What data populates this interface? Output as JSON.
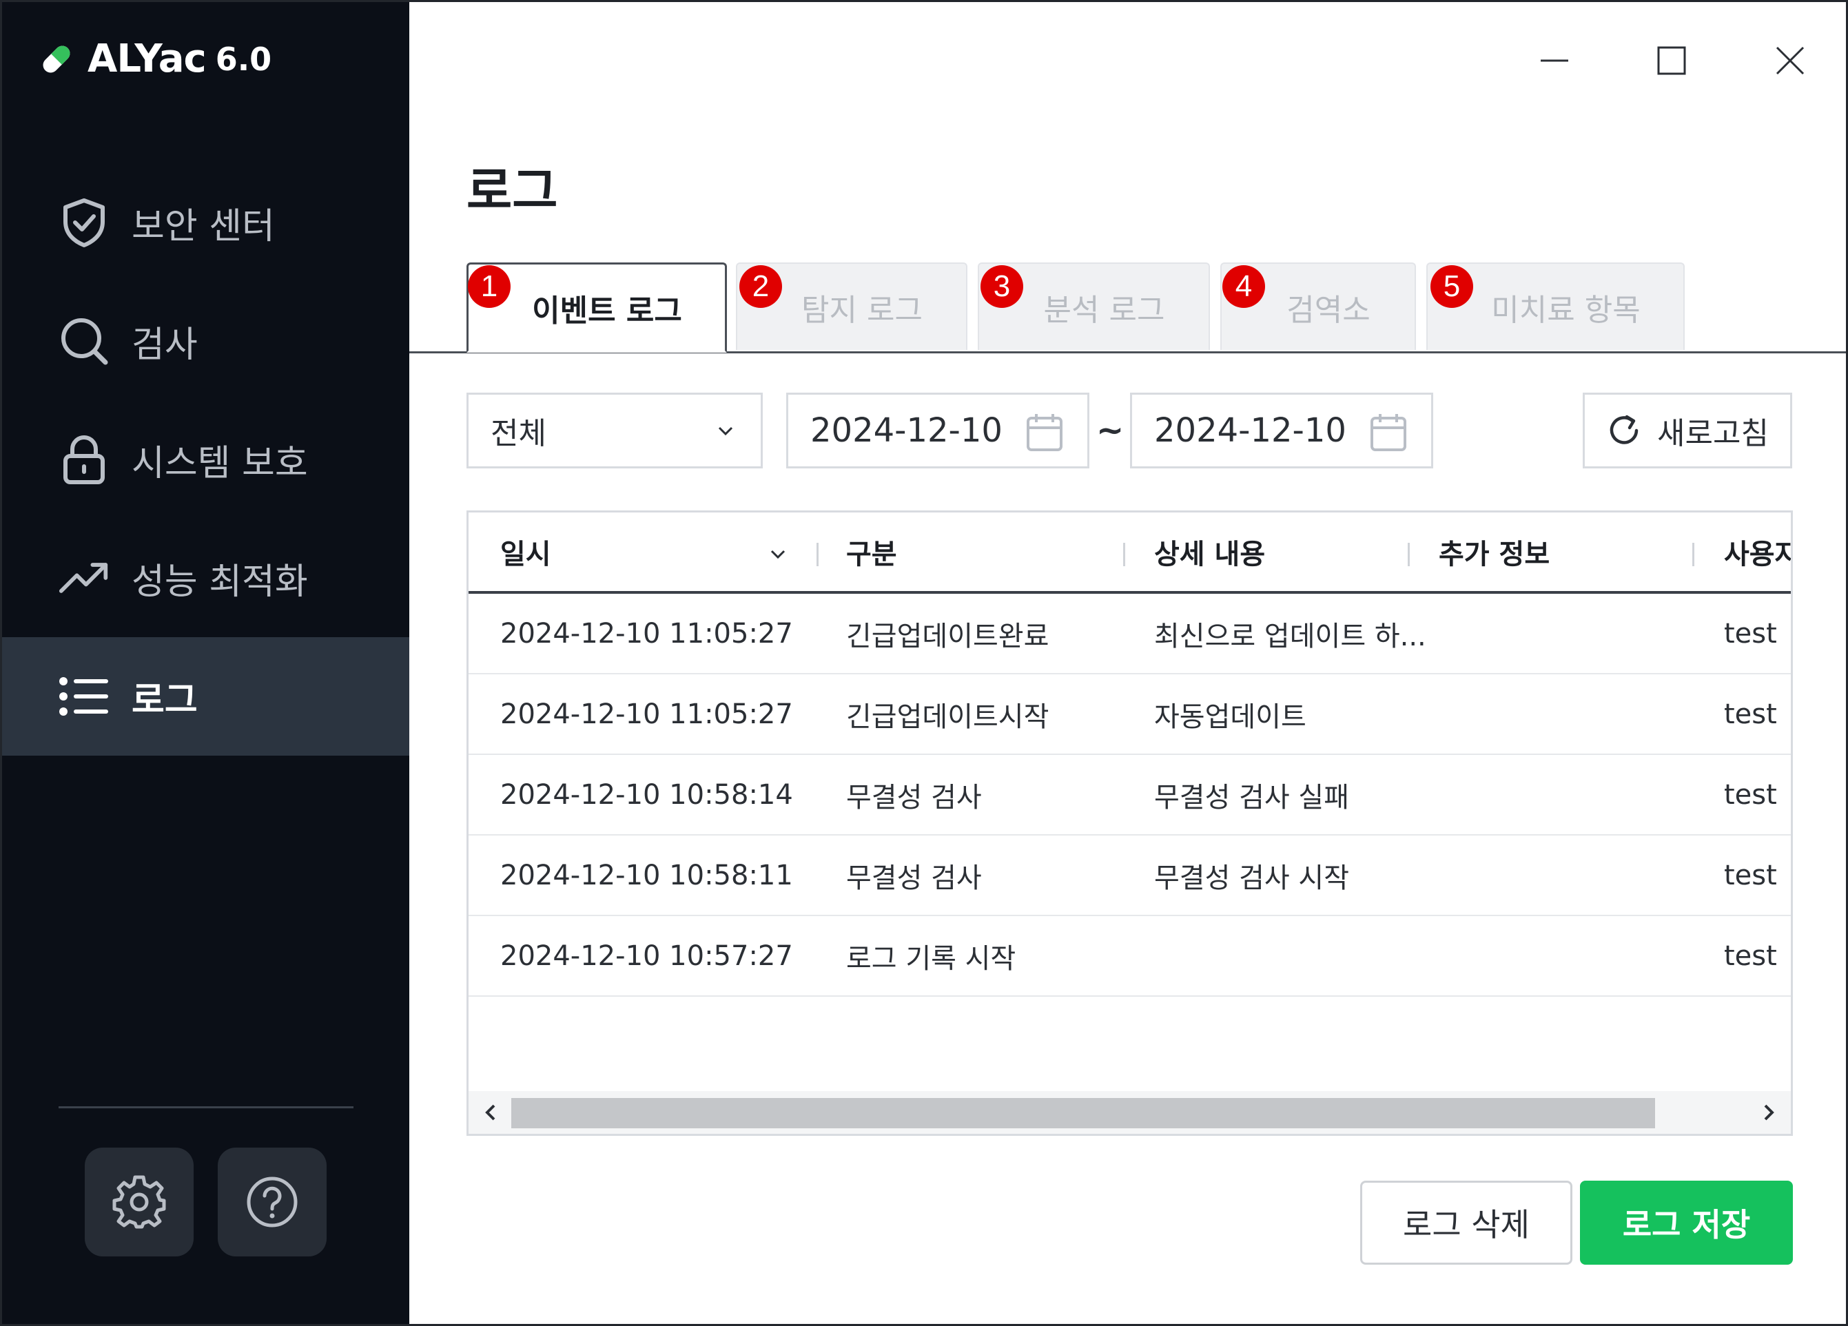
{
  "app": {
    "name": "ALYac",
    "version": "6.0"
  },
  "sidebar": {
    "items": [
      {
        "label": "보안 센터",
        "icon": "shield-check-icon"
      },
      {
        "label": "검사",
        "icon": "search-icon"
      },
      {
        "label": "시스템 보호",
        "icon": "lock-icon"
      },
      {
        "label": "성능 최적화",
        "icon": "trend-up-icon"
      },
      {
        "label": "로그",
        "icon": "list-icon",
        "active": true
      }
    ],
    "bottom_buttons": [
      {
        "icon": "gear-icon"
      },
      {
        "icon": "help-icon"
      }
    ]
  },
  "window_controls": {
    "minimize": "minimize-icon",
    "maximize": "maximize-icon",
    "close": "close-icon"
  },
  "page": {
    "title": "로그"
  },
  "tabs": [
    {
      "label": "이벤트 로그",
      "badge": "1",
      "active": true
    },
    {
      "label": "탐지 로그",
      "badge": "2"
    },
    {
      "label": "분석 로그",
      "badge": "3"
    },
    {
      "label": "검역소",
      "badge": "4"
    },
    {
      "label": "미치료 항목",
      "badge": "5"
    }
  ],
  "filter": {
    "category": "전체",
    "date_from": "2024-12-10",
    "date_to": "2024-12-10",
    "separator": "~",
    "refresh_label": "새로고침"
  },
  "table": {
    "columns": [
      "일시",
      "구분",
      "상세 내용",
      "추가 정보",
      "사용자"
    ],
    "rows": [
      [
        "2024-12-10 11:05:27",
        "긴급업데이트완료",
        "최신으로 업데이트 하...",
        "",
        "test"
      ],
      [
        "2024-12-10 11:05:27",
        "긴급업데이트시작",
        "자동업데이트",
        "",
        "test"
      ],
      [
        "2024-12-10 10:58:14",
        "무결성 검사",
        "무결성 검사 실패",
        "",
        "test"
      ],
      [
        "2024-12-10 10:58:11",
        "무결성 검사",
        "무결성 검사 시작",
        "",
        "test"
      ],
      [
        "2024-12-10 10:57:27",
        "로그 기록 시작",
        "",
        "",
        "test"
      ]
    ]
  },
  "actions": {
    "delete_label": "로그 삭제",
    "save_label": "로그 저장"
  },
  "colors": {
    "sidebar_bg": "#0b0f17",
    "active_nav_bg": "#2b3440",
    "accent_green": "#15c15d",
    "badge_red": "#e00000"
  }
}
